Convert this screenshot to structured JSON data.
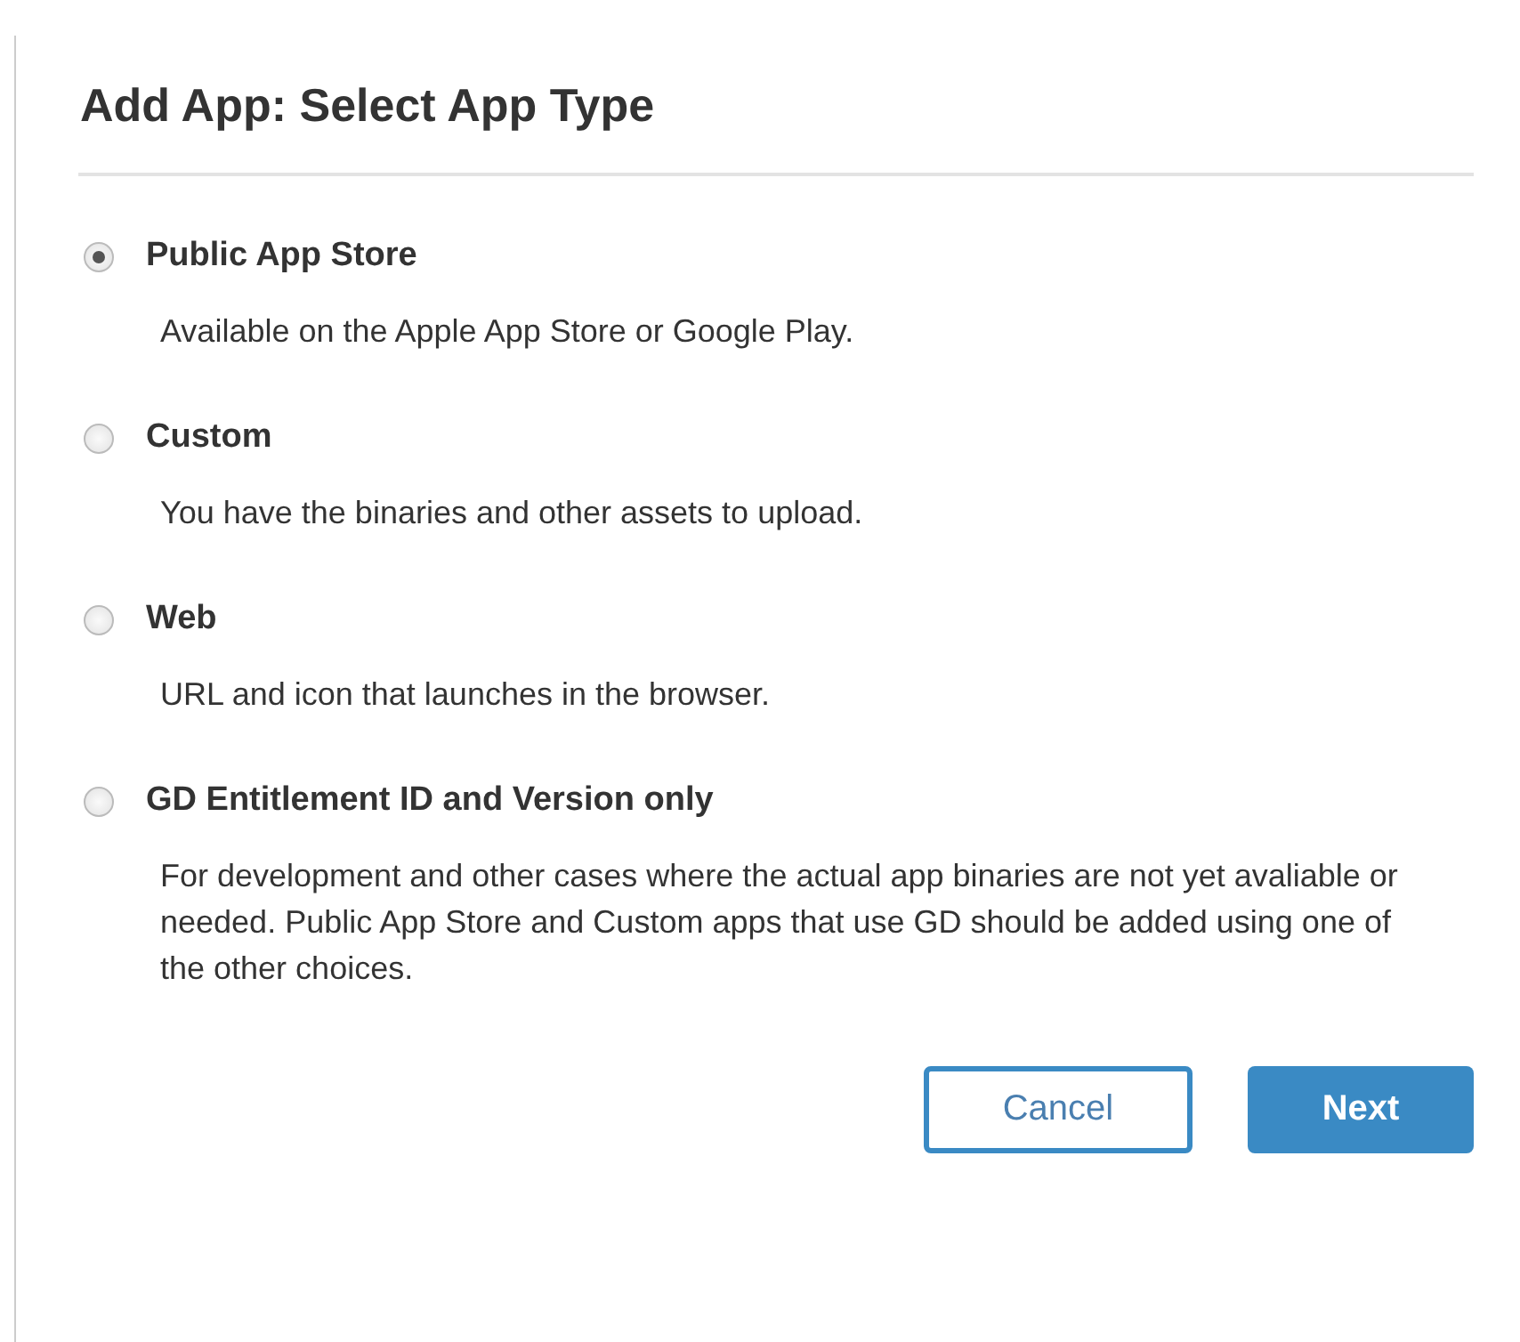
{
  "dialog": {
    "title": "Add App: Select App Type",
    "options": [
      {
        "label": "Public App Store",
        "description": "Available on the Apple App Store or Google Play.",
        "selected": true
      },
      {
        "label": "Custom",
        "description": "You have the binaries and other assets to upload.",
        "selected": false
      },
      {
        "label": "Web",
        "description": "URL and icon that launches in the browser.",
        "selected": false
      },
      {
        "label": "GD Entitlement ID and Version only",
        "description": "For development and other cases where the actual app binaries are not yet avaliable or needed. Public App Store and Custom apps that use GD should be added using one of the other choices.",
        "selected": false
      }
    ],
    "buttons": [
      {
        "label": "Cancel",
        "kind": "secondary"
      },
      {
        "label": "Next",
        "kind": "primary"
      }
    ]
  }
}
